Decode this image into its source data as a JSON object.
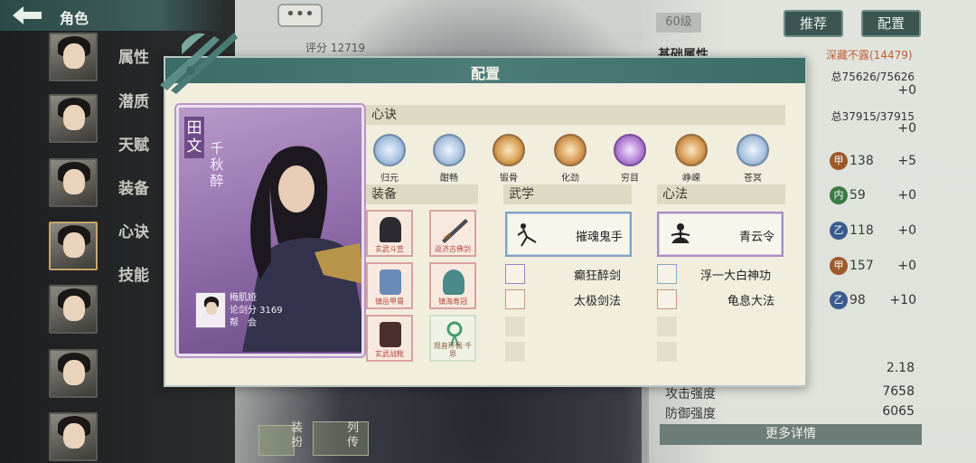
{
  "header": {
    "title": "角色"
  },
  "side_tabs": [
    "属性",
    "潜质",
    "天赋",
    "装备",
    "心诀",
    "技能"
  ],
  "top_right": {
    "level": "60级",
    "recommend_btn": "推荐",
    "config_btn": "配置"
  },
  "score_label": "评分 12719",
  "base_attr_heading": "基础属性",
  "hidden_label": "深藏不露(14479)",
  "attr_rows": [
    {
      "value": "总75626/75626",
      "delta": "+0"
    },
    {
      "value": "总37915/37915",
      "delta": "+0"
    }
  ],
  "stat_rows": [
    {
      "badge": "甲",
      "value": "138",
      "delta": "+5"
    },
    {
      "badge": "内",
      "value": "59",
      "delta": "+0"
    },
    {
      "badge": "乙",
      "value": "118",
      "delta": "+0"
    },
    {
      "badge": "甲",
      "value": "157",
      "delta": "+0"
    },
    {
      "badge": "乙",
      "value": "98",
      "delta": "+10"
    }
  ],
  "bottom_stats": [
    {
      "label": "",
      "value": "2.18"
    },
    {
      "label": "攻击强度",
      "value": "7658"
    },
    {
      "label": "防御强度",
      "value": "6065"
    }
  ],
  "more_details": "更多详情",
  "bottom_tabs": [
    "装扮",
    "列传"
  ],
  "dialog": {
    "title": "配置",
    "character": {
      "name": "田文",
      "title": "千秋醉"
    },
    "owner": {
      "name": "梅肌娅",
      "score_line": "论剑分 3169",
      "guild_line": "帮　会"
    },
    "xinjue_head": "心诀",
    "xinjue": [
      "归元",
      "酣畅",
      "锻骨",
      "化劲",
      "穷目",
      "峥嵘",
      "苍冥"
    ],
    "equip_head": "装备",
    "equipment": [
      "玄武斗笠",
      "返济古佛剑",
      "镇岳甲胄",
      "镇海寿冠",
      "玄武战靴",
      "观音环佩·千思"
    ],
    "wuxue_head": "武学",
    "wuxue_main": "摧魂鬼手",
    "wuxue_list": [
      "癫狂醉剑",
      "太极剑法"
    ],
    "xinfa_head": "心法",
    "xinfa_main": "青云令",
    "xinfa_list": [
      "浮一大白神功",
      "龟息大法"
    ]
  }
}
